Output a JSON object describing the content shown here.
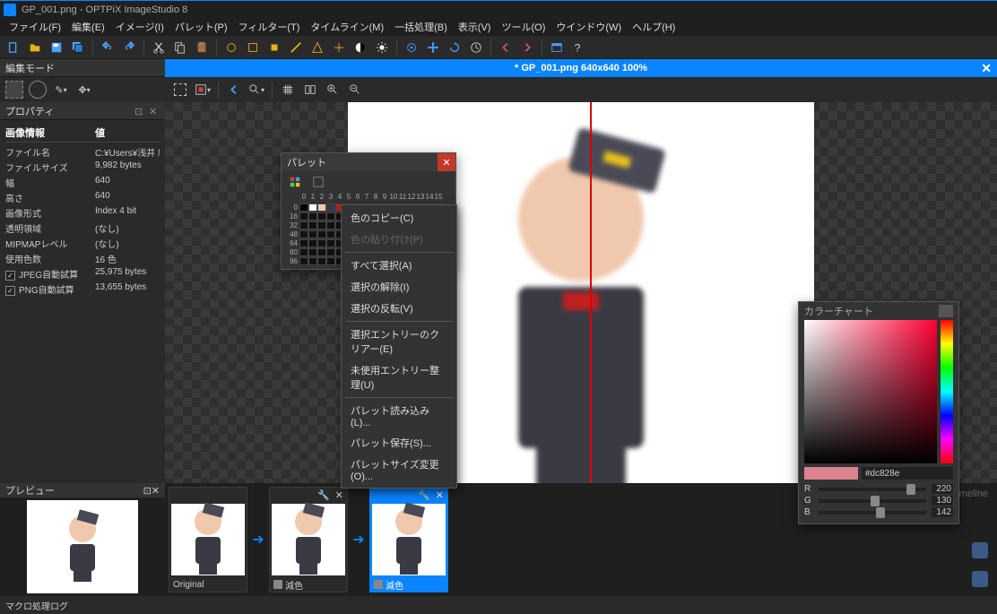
{
  "title": "GP_001.png - OPTPiX ImageStudio 8",
  "menu": [
    "ファイル(F)",
    "編集(E)",
    "イメージ(I)",
    "パレット(P)",
    "フィルター(T)",
    "タイムライン(M)",
    "一括処理(B)",
    "表示(V)",
    "ツール(O)",
    "ウインドウ(W)",
    "ヘルプ(H)"
  ],
  "doc_tab": "* GP_001.png 640x640 100%",
  "panels": {
    "edit_mode": "編集モード",
    "property": "プロパティ",
    "preview": "プレビュー"
  },
  "props": {
    "section": "画像情報",
    "value_hdr": "値",
    "rows": [
      {
        "k": "ファイル名",
        "v": "C:¥Users¥浅井 維新¥"
      },
      {
        "k": "ファイルサイズ",
        "v": "9,982 bytes"
      },
      {
        "k": "幅",
        "v": "640"
      },
      {
        "k": "高さ",
        "v": "640"
      },
      {
        "k": "画像形式",
        "v": "Index 4 bit"
      },
      {
        "k": "透明領域",
        "v": "(なし)"
      },
      {
        "k": "MIPMAPレベル",
        "v": "(なし)"
      },
      {
        "k": "使用色数",
        "v": "16 色"
      }
    ],
    "jpeg": {
      "label": "JPEG自動試算",
      "val": "25,975 bytes"
    },
    "png": {
      "label": "PNG自動試算",
      "val": "13,655 bytes"
    }
  },
  "palette": {
    "title": "パレット",
    "cols": [
      "0",
      "1",
      "2",
      "3",
      "4",
      "5",
      "6",
      "7",
      "8",
      "9",
      "10",
      "11",
      "12",
      "13",
      "14",
      "15"
    ],
    "rows": [
      "0",
      "16",
      "32",
      "48",
      "64",
      "80",
      "96"
    ]
  },
  "ctx": {
    "copy": "色のコピー(C)",
    "paste": "色の貼り付け(P)",
    "selall": "すべて選択(A)",
    "desel": "選択の解除(I)",
    "inv": "選択の反転(V)",
    "clear": "選択エントリーのクリアー(E)",
    "unused": "未使用エントリー整理(U)",
    "load": "パレット読み込み(L)...",
    "save": "パレット保存(S)...",
    "resize": "パレットサイズ変更(O)..."
  },
  "colorchart": {
    "title": "カラーチャート",
    "hex": "#dc828e",
    "r": {
      "label": "R",
      "val": "220"
    },
    "g": {
      "label": "G",
      "val": "130"
    },
    "b": {
      "label": "B",
      "val": "142"
    }
  },
  "frames": {
    "original": "Original",
    "gensyoku": "減色",
    "timeline": "Timeline"
  },
  "status": "マクロ処理ログ"
}
